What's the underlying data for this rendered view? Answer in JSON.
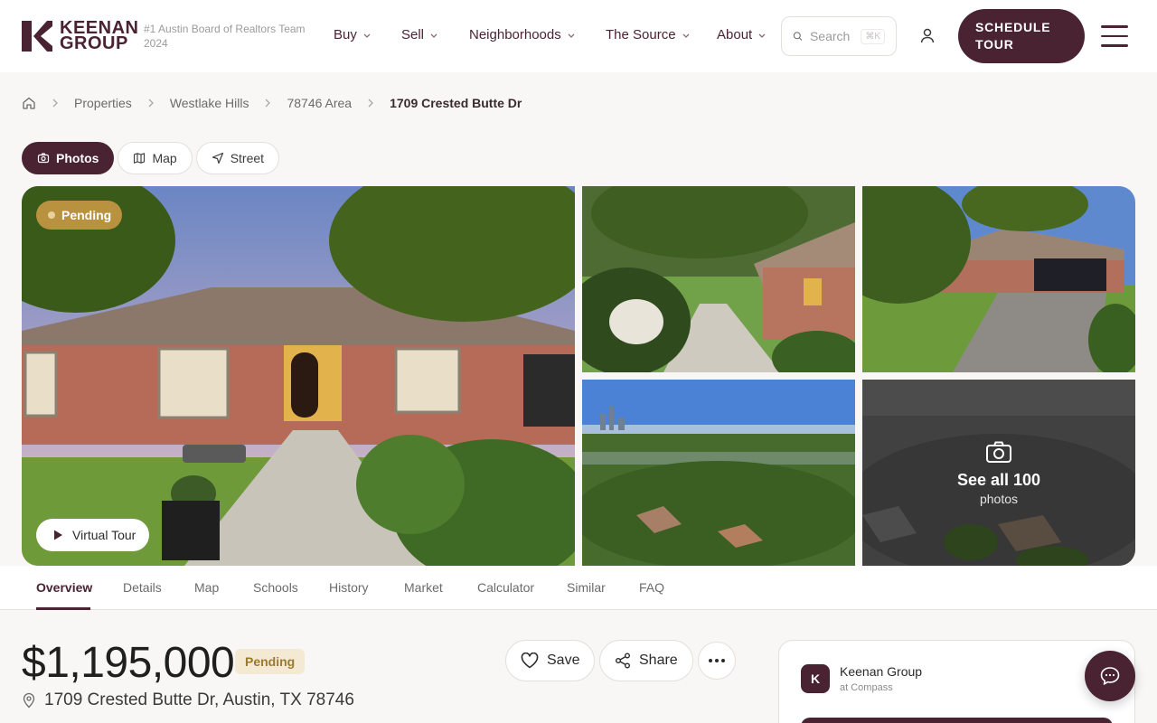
{
  "brand": {
    "line1": "KEENAN",
    "line2": "GROUP",
    "tagline": "#1 Austin Board of Realtors Team 2024"
  },
  "nav": [
    {
      "label": "Buy"
    },
    {
      "label": "Sell"
    },
    {
      "label": "Neighborhoods"
    },
    {
      "label": "The Source"
    },
    {
      "label": "About"
    }
  ],
  "search": {
    "placeholder": "Search",
    "shortcut": "⌘K"
  },
  "cta": {
    "line1": "SCHEDULE",
    "line2": "TOUR"
  },
  "breadcrumb": {
    "items": [
      "Properties",
      "Westlake Hills",
      "78746 Area"
    ],
    "current": "1709 Crested Butte Dr"
  },
  "views": [
    {
      "label": "Photos"
    },
    {
      "label": "Map"
    },
    {
      "label": "Street"
    }
  ],
  "gallery": {
    "status": "Pending",
    "virtual_tour": "Virtual Tour",
    "see_all_title": "See all 100",
    "see_all_sub": "photos"
  },
  "tabs": [
    "Overview",
    "Details",
    "Map",
    "Schools",
    "History",
    "Market",
    "Calculator",
    "Similar",
    "FAQ"
  ],
  "listing": {
    "price": "$1,195,000",
    "status": "Pending",
    "address": "1709 Crested Butte Dr, Austin, TX 78746"
  },
  "actions": {
    "save": "Save",
    "share": "Share"
  },
  "agent": {
    "initial": "K",
    "name": "Keenan Group",
    "brokerage": "at Compass"
  },
  "colors": {
    "brand": "#4a2332",
    "pending": "#b8923f"
  }
}
